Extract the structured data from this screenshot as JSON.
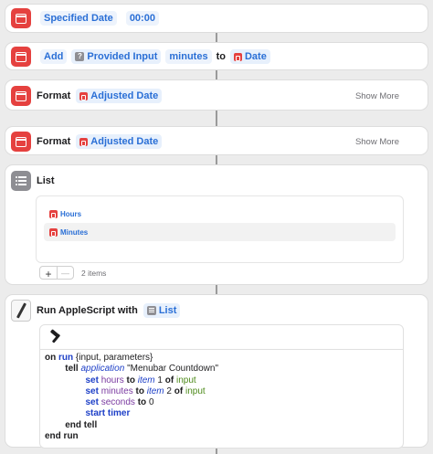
{
  "actions": {
    "specified_date": {
      "value": "Specified Date",
      "time": "00:00"
    },
    "adjust_date": {
      "verb": "Add",
      "input": "Provided Input",
      "unit": "minutes",
      "connector": "to",
      "target": "Date"
    },
    "format_1": {
      "verb": "Format",
      "var": "Adjusted Date",
      "show_more": "Show More"
    },
    "format_2": {
      "verb": "Format",
      "var": "Adjusted Date",
      "show_more": "Show More"
    },
    "list": {
      "title": "List",
      "items": [
        {
          "label": "Hours"
        },
        {
          "label": "Minutes"
        }
      ],
      "add_symbol": "+",
      "remove_symbol": "—",
      "count": "2 items"
    },
    "applescript": {
      "title": "Run AppleScript with",
      "input_var": "List",
      "code": {
        "l1_on": "on",
        "l1_run": "run",
        "l1_rest": " {input, parameters}",
        "l2_tell": "tell",
        "l2_app": "application",
        "l2_name": "\"Menubar Countdown\"",
        "l3_set": "set",
        "l3_prop": "hours",
        "l3_to": "to",
        "l3_item": "item",
        "l3_num": "1",
        "l3_of": "of",
        "l3_input": "input",
        "l4_set": "set",
        "l4_prop": "minutes",
        "l4_to": "to",
        "l4_item": "item",
        "l4_num": "2",
        "l4_of": "of",
        "l4_input": "input",
        "l5_set": "set",
        "l5_prop": "seconds",
        "l5_to": "to",
        "l5_num": "0",
        "l6": "start timer",
        "l7": "end tell",
        "l8": "end run"
      }
    }
  },
  "colors": {
    "accent_blue": "#2a6fd6",
    "calendar_red": "#e5413f",
    "keyword_blue": "#1d3fc7",
    "property_purple": "#7a3aa0",
    "string_green": "#4d8a1a",
    "background": "#ececec"
  },
  "icons": {
    "calendar": "calendar-icon",
    "list": "list-icon",
    "script": "script-editor-icon",
    "compile": "hammer-icon",
    "variable": "variable-icon"
  }
}
